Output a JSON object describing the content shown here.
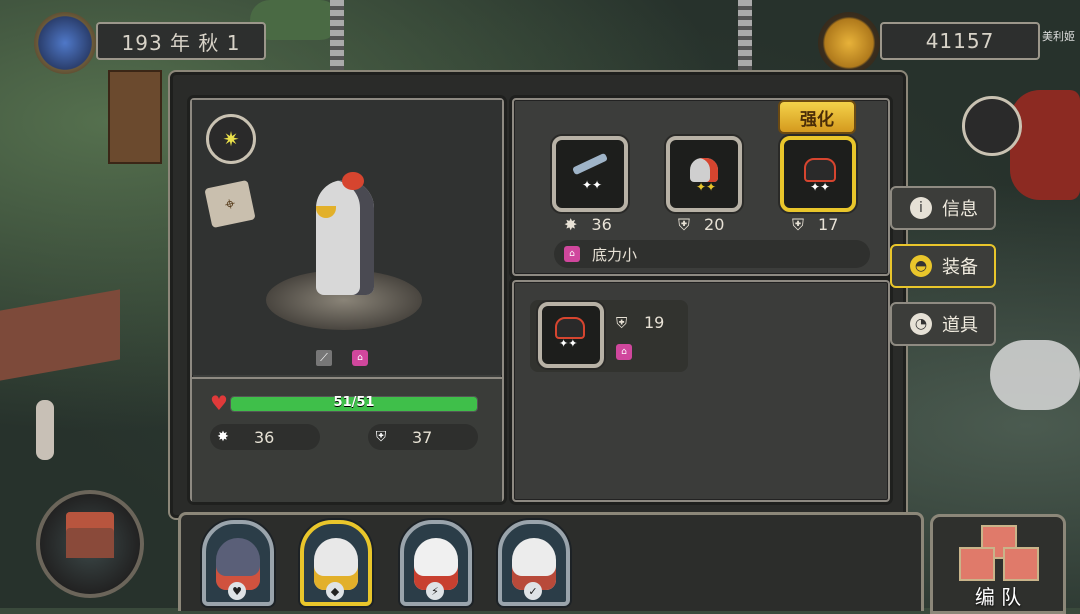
{
  "top": {
    "date_text": "193 年 秋 1",
    "gold": "41157",
    "corner_text": "美利姬"
  },
  "hero": {
    "hp_text": "51/51",
    "hp_fraction": 1.0,
    "attack": "36",
    "defense": "37",
    "rank_icon": "sunburst-rank-icon",
    "tool_icon": "spyglass-map-icon"
  },
  "equipment": {
    "enhance_label": "强化",
    "slots": [
      {
        "icon": "sword-claw-icon",
        "stat_icon": "attack-icon",
        "value": "36"
      },
      {
        "icon": "spiked-helm-icon",
        "stat_icon": "shield-icon",
        "value": "20"
      },
      {
        "icon": "shoulder-armor-icon",
        "stat_icon": "shield-icon",
        "value": "17",
        "selected": true
      }
    ],
    "trait_label": "底力小"
  },
  "inventory": {
    "items": [
      {
        "icon": "shoulder-armor-icon",
        "stat_icon": "shield-icon",
        "value": "19"
      }
    ]
  },
  "side_tabs": [
    {
      "label": "信息",
      "icon": "info-icon",
      "active": false
    },
    {
      "label": "装备",
      "icon": "helmet-icon",
      "active": true
    },
    {
      "label": "道具",
      "icon": "pouch-icon",
      "active": false
    }
  ],
  "team_button_label": "编 队",
  "portraits": [
    {
      "name": "pirate-bear",
      "badge": "♥",
      "selected": false
    },
    {
      "name": "eagle-knight",
      "badge": "◆",
      "selected": true
    },
    {
      "name": "polar-bear",
      "badge": "⚡",
      "selected": false
    },
    {
      "name": "sheep-warrior",
      "badge": "✓",
      "selected": false
    }
  ],
  "colors": {
    "hp_green": "#3fbf4a",
    "selected_gold": "#e9c62b",
    "trait_pink": "#d0479d"
  }
}
